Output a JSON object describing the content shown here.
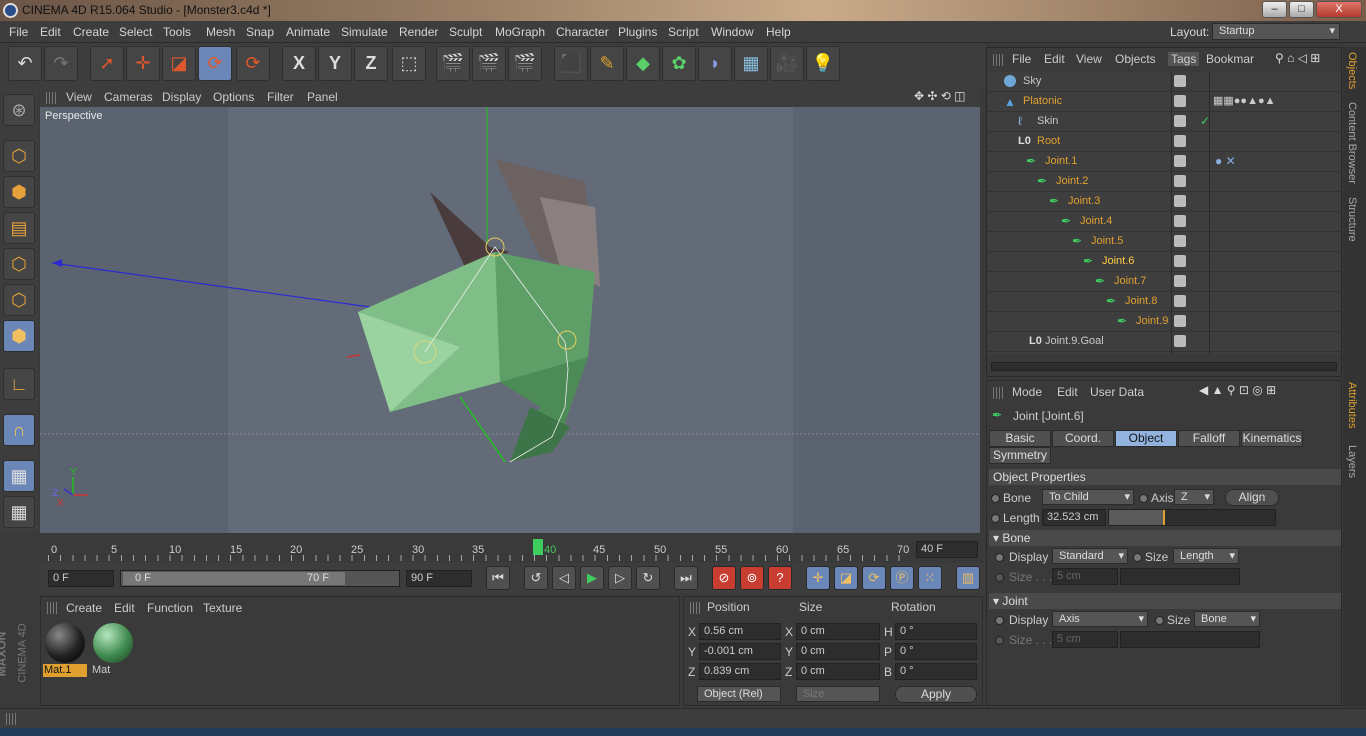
{
  "window": {
    "title": "CINEMA 4D R15.064 Studio - [Monster3.c4d *]",
    "minimize": "–",
    "maximize": "□",
    "close": "X"
  },
  "menu": [
    "File",
    "Edit",
    "Create",
    "Select",
    "Tools",
    "Mesh",
    "Snap",
    "Animate",
    "Simulate",
    "Render",
    "Sculpt",
    "MoGraph",
    "Character",
    "Plugins",
    "Script",
    "Window",
    "Help"
  ],
  "layout": {
    "label": "Layout:",
    "value": "Startup"
  },
  "toolbar": {
    "x": "X",
    "y": "Y",
    "z": "Z"
  },
  "viewport": {
    "menu": [
      "View",
      "Cameras",
      "Display",
      "Options",
      "Filter",
      "Panel"
    ],
    "label": "Perspective",
    "axis_y": "Y",
    "axis_x": "X",
    "axis_z": "Z"
  },
  "timeline": {
    "ticks": [
      "0",
      "5",
      "10",
      "15",
      "20",
      "25",
      "30",
      "35",
      "40",
      "45",
      "50",
      "55",
      "60",
      "65",
      "70"
    ],
    "current": "40",
    "frame_field": "40 F"
  },
  "playback": {
    "start": "0 F",
    "range_start": "0 F",
    "range_end": "70 F",
    "end": "90 F"
  },
  "materials": {
    "menu": [
      "Create",
      "Edit",
      "Function",
      "Texture"
    ],
    "items": [
      {
        "name": "Mat.1",
        "color": "#222222"
      },
      {
        "name": "Mat",
        "color": "#3f8a4e"
      }
    ]
  },
  "coordinates": {
    "headers": [
      "Position",
      "Size",
      "Rotation"
    ],
    "rows": [
      {
        "pos_label": "X",
        "pos": "0.56 cm",
        "size_label": "X",
        "size": "0 cm",
        "rot_label": "H",
        "rot": "0 °"
      },
      {
        "pos_label": "Y",
        "pos": "-0.001 cm",
        "size_label": "Y",
        "size": "0 cm",
        "rot_label": "P",
        "rot": "0 °"
      },
      {
        "pos_label": "Z",
        "pos": "0.839 cm",
        "size_label": "Z",
        "size": "0 cm",
        "rot_label": "B",
        "rot": "0 °"
      }
    ],
    "mode": "Object (Rel)",
    "size_mode": "Size",
    "apply": "Apply"
  },
  "objects": {
    "menu": [
      "File",
      "Edit",
      "View",
      "Objects",
      "Tags",
      "Bookmar"
    ],
    "items": [
      {
        "name": "Sky",
        "depth": 0,
        "color": "#c8c8c8"
      },
      {
        "name": "Platonic",
        "depth": 0,
        "color": "#e0a030"
      },
      {
        "name": "Skin",
        "depth": 1,
        "color": "#c8c8c8"
      },
      {
        "name": "Root",
        "depth": 1,
        "color": "#e0a030"
      },
      {
        "name": "Joint.1",
        "depth": 2,
        "color": "#e0a030"
      },
      {
        "name": "Joint.2",
        "depth": 3,
        "color": "#e0a030"
      },
      {
        "name": "Joint.3",
        "depth": 4,
        "color": "#e0a030"
      },
      {
        "name": "Joint.4",
        "depth": 5,
        "color": "#e0a030"
      },
      {
        "name": "Joint.5",
        "depth": 6,
        "color": "#e0a030"
      },
      {
        "name": "Joint.6",
        "depth": 7,
        "color": "#ffcc44"
      },
      {
        "name": "Joint.7",
        "depth": 8,
        "color": "#e0a030"
      },
      {
        "name": "Joint.8",
        "depth": 9,
        "color": "#e0a030"
      },
      {
        "name": "Joint.9",
        "depth": 10,
        "color": "#e0a030"
      },
      {
        "name": "Joint.9.Goal",
        "depth": 1,
        "color": "#c8c8c8"
      }
    ]
  },
  "attributes": {
    "menu": [
      "Mode",
      "Edit",
      "User Data"
    ],
    "object_title": "Joint [Joint.6]",
    "tabs": [
      "Basic",
      "Coord.",
      "Object",
      "Falloff",
      "Kinematics",
      "Symmetry"
    ],
    "active_tab": "Object",
    "section": "Object Properties",
    "bone_label": "Bone",
    "bone_value": "To Child",
    "axis_label": "Axis",
    "axis_value": "Z",
    "align": "Align",
    "length_label": "Length",
    "length_value": "32.523 cm",
    "length_fraction": 0.34,
    "bone_group": "Bone",
    "display_label": "Display",
    "bone_display": "Standard",
    "size_label": "Size",
    "bone_size": "Length",
    "size_field_label": "Size . . .",
    "bone_size_value": "5 cm",
    "joint_group": "Joint",
    "joint_display": "Axis",
    "joint_size": "Bone",
    "joint_size_value": "5 cm"
  },
  "side_tabs": [
    "Objects",
    "Content Browser",
    "Structure",
    "Attributes",
    "Layers"
  ],
  "brand": {
    "maxon": "MAXON",
    "product": "CINEMA 4D"
  }
}
